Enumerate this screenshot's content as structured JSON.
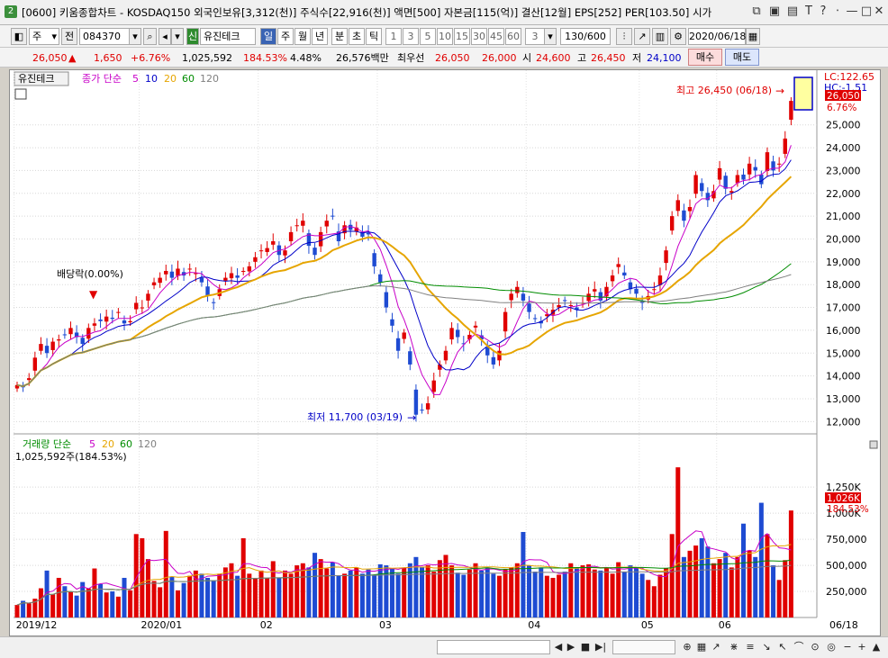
{
  "window": {
    "icon_label": "2",
    "title": "[0600] 키움종합차트 - KOSDAQ150 외국인보유[3,312(천)] 주식수[22,916(천)] 액면[500] 자본금[115(억)] 결산[12월] EPS[252] PER[103.50] 시가"
  },
  "toolbar": {
    "period_label": "주",
    "prev_label": "전",
    "code": "084370",
    "new_badge": "신",
    "stock_name": "유진테크",
    "periods": [
      "일",
      "주",
      "월",
      "년",
      "분",
      "초",
      "틱"
    ],
    "active_period": "일",
    "intervals": [
      "1",
      "3",
      "5",
      "10",
      "15",
      "30",
      "45",
      "60"
    ],
    "custom_interval": "3",
    "count": "130/600",
    "date": "2020/06/18"
  },
  "quote": {
    "price": "26,050",
    "change": "1,650",
    "change_pct": "+6.76%",
    "volume": "1,025,592",
    "volume_ratio": "184.53%",
    "turnover_pct": "4.48%",
    "trade_value": "26,576백만",
    "best_label": "최우선",
    "best_ask": "26,050",
    "best_bid": "26,000",
    "open_label": "시",
    "open": "24,600",
    "high_label": "고",
    "high": "26,450",
    "low_label": "저",
    "low": "24,100",
    "buy_label": "매수",
    "sell_label": "매도"
  },
  "colors": {
    "up": "#e00000",
    "down": "#1e4bd2",
    "ma5": "#c800c8",
    "ma10": "#0000c8",
    "ma20": "#e6a500",
    "ma60": "#008c00",
    "ma120": "#808080"
  },
  "legend": {
    "stock": "유진테크",
    "price_title": "종가 단순",
    "ma": [
      "5",
      "10",
      "20",
      "60",
      "120"
    ],
    "vol_title": "거래량 단순",
    "vol_value": "1,025,592주(184.53%)"
  },
  "annotations": {
    "dividend": "배당락(0.00%)",
    "high_mark": "최고 26,450 (06/18)",
    "low_mark": "최저 11,700 (03/19)",
    "lc": "LC:122.65",
    "hc": "HC:-1.51",
    "price_tag": "26,050",
    "pct_tag": "6.76%",
    "vol_tag": "1,026K",
    "vol_pct_tag": "184.53%"
  },
  "chart_data": {
    "type": "candlestick",
    "price_axis": {
      "min": 11500,
      "max": 27000,
      "ticks": [
        "25,000",
        "24,000",
        "23,000",
        "22,000",
        "21,000",
        "20,000",
        "19,000",
        "18,000",
        "17,000",
        "16,000",
        "15,000",
        "14,000",
        "13,000",
        "12,000"
      ]
    },
    "volume_axis": {
      "min": 0,
      "max": 1450000,
      "ticks": [
        "1,250K",
        "1,000K",
        "750,000",
        "500,000",
        "250,000"
      ]
    },
    "x_labels": [
      "2019/12",
      "2020/01",
      "02",
      "03",
      "04",
      "05",
      "06"
    ],
    "x_label_right": "06/18",
    "close": [
      13600,
      13500,
      13900,
      14800,
      15400,
      15000,
      15500,
      15600,
      15800,
      16100,
      15700,
      15400,
      16100,
      16300,
      16400,
      16600,
      16500,
      16800,
      16300,
      16400,
      17200,
      17000,
      17600,
      18100,
      18300,
      18600,
      18300,
      18700,
      18400,
      18700,
      18500,
      18100,
      17500,
      17200,
      17800,
      18300,
      18500,
      18300,
      18600,
      18800,
      19200,
      19500,
      19600,
      19900,
      19300,
      19500,
      20300,
      20600,
      20800,
      19700,
      19300,
      20300,
      20800,
      21000,
      19900,
      20600,
      20400,
      20500,
      20100,
      20200,
      18800,
      18100,
      17000,
      16200,
      15100,
      15900,
      14500,
      12300,
      12500,
      12800,
      13800,
      14500,
      15100,
      16100,
      15700,
      15400,
      15800,
      16200,
      15600,
      14900,
      14500,
      15100,
      16800,
      17600,
      17900,
      17300,
      16800,
      16500,
      16300,
      16700,
      16900,
      17100,
      17300,
      17100,
      16900,
      17200,
      17600,
      17800,
      17300,
      17900,
      18400,
      18900,
      18400,
      17800,
      17600,
      17200,
      17500,
      17800,
      18400,
      19500,
      21000,
      21700,
      20800,
      21400,
      22800,
      22100,
      21700,
      22100,
      23100,
      22200,
      22100,
      22800,
      22600,
      23300,
      23000,
      22400,
      23800,
      23000,
      23300,
      24400,
      26050
    ],
    "volume": [
      120000,
      160000,
      135000,
      180000,
      280000,
      450000,
      220000,
      380000,
      300000,
      250000,
      210000,
      340000,
      280000,
      470000,
      320000,
      240000,
      250000,
      200000,
      380000,
      260000,
      800000,
      760000,
      560000,
      350000,
      290000,
      830000,
      390000,
      260000,
      330000,
      400000,
      450000,
      420000,
      380000,
      350000,
      420000,
      480000,
      520000,
      400000,
      760000,
      420000,
      380000,
      450000,
      380000,
      540000,
      380000,
      450000,
      420000,
      500000,
      520000,
      480000,
      620000,
      560000,
      470000,
      530000,
      400000,
      420000,
      450000,
      480000,
      420000,
      460000,
      410000,
      510000,
      500000,
      470000,
      420000,
      480000,
      520000,
      580000,
      480000,
      500000,
      440000,
      550000,
      600000,
      500000,
      430000,
      410000,
      460000,
      520000,
      450000,
      480000,
      420000,
      400000,
      460000,
      480000,
      520000,
      820000,
      500000,
      440000,
      480000,
      400000,
      380000,
      410000,
      440000,
      520000,
      470000,
      500000,
      510000,
      460000,
      450000,
      480000,
      420000,
      530000,
      440000,
      500000,
      480000,
      420000,
      360000,
      300000,
      410000,
      470000,
      800000,
      1440000,
      580000,
      640000,
      690000,
      760000,
      680000,
      520000,
      560000,
      620000,
      480000,
      580000,
      900000,
      640000,
      580000,
      1100000,
      800000,
      500000,
      360000,
      550000,
      1026000
    ]
  }
}
